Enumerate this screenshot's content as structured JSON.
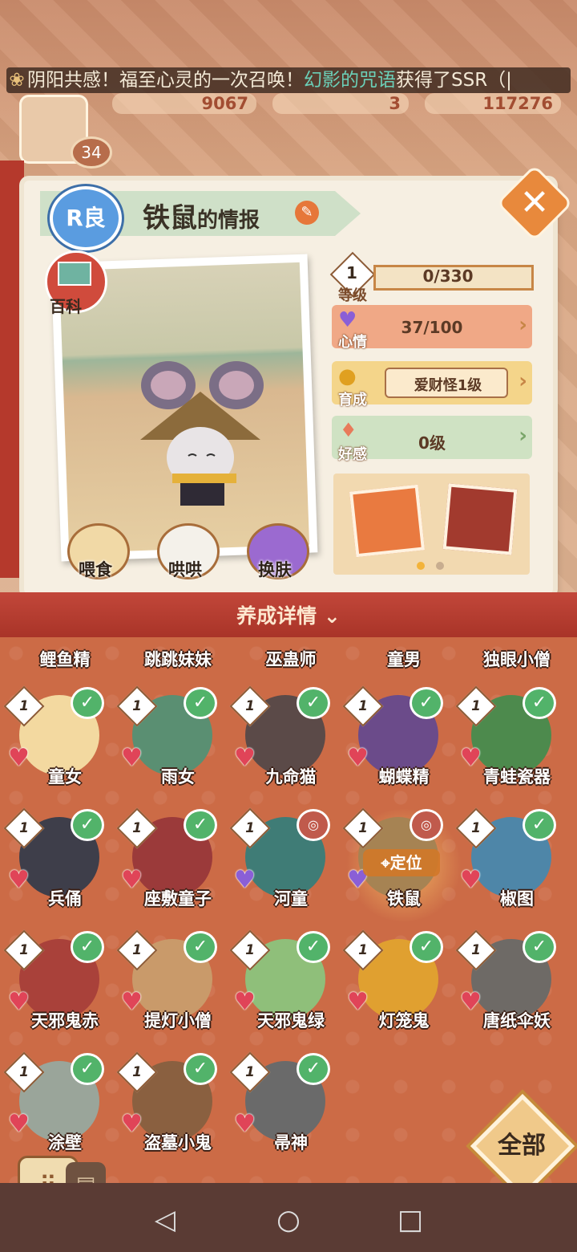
{
  "marquee": {
    "prefix": "阴阳共感！福至心灵的一次召唤！",
    "highlight": "幻影的咒语",
    "suffix": "获得了SSR（|"
  },
  "currency": {
    "jade": "9067",
    "tickets": "3",
    "coins": "117276"
  },
  "player_level": "34",
  "card": {
    "rarity": "R良",
    "name": "铁鼠",
    "title_suffix": "的情报",
    "encyclopedia": "百科"
  },
  "stats": {
    "level": {
      "label": "等级",
      "badge": "1",
      "value": "0/330"
    },
    "mood": {
      "label": "心情",
      "value": "37/100"
    },
    "growth": {
      "label": "育成",
      "value": "爱财怪1级"
    },
    "affection": {
      "label": "好感",
      "value": "0级"
    }
  },
  "actions": [
    {
      "label": "喂食"
    },
    {
      "label": "哄哄"
    },
    {
      "label": "换肤"
    }
  ],
  "training_label": "养成详情",
  "partial_row": [
    "鲤鱼精",
    "跳跳妹妹",
    "巫蛊师",
    "童男",
    "独眼小僧"
  ],
  "shikigami": [
    {
      "name": "童女",
      "level": "1",
      "heart": "red",
      "owned": true,
      "color": "#f3d9a0"
    },
    {
      "name": "雨女",
      "level": "1",
      "heart": "red",
      "owned": true,
      "color": "#5a8f72"
    },
    {
      "name": "九命猫",
      "level": "1",
      "heart": "red",
      "owned": true,
      "color": "#5b4a48"
    },
    {
      "name": "蝴蝶精",
      "level": "1",
      "heart": "red",
      "owned": true,
      "color": "#6b4b8a"
    },
    {
      "name": "青蛙瓷器",
      "level": "1",
      "heart": "red",
      "owned": true,
      "color": "#4d8a4d"
    },
    {
      "name": "兵俑",
      "level": "1",
      "heart": "red",
      "owned": true,
      "color": "#3e3e4a"
    },
    {
      "name": "座敷童子",
      "level": "1",
      "heart": "red",
      "owned": true,
      "color": "#9b3a3a"
    },
    {
      "name": "河童",
      "level": "1",
      "heart": "purple",
      "owned": false,
      "color": "#3f7c76"
    },
    {
      "name": "铁鼠",
      "level": "1",
      "heart": "purple",
      "owned": false,
      "color": "#a68353",
      "locate": "定位"
    },
    {
      "name": "椒图",
      "level": "1",
      "heart": "red",
      "owned": true,
      "color": "#4e86a8"
    },
    {
      "name": "天邪鬼赤",
      "level": "1",
      "heart": "red",
      "owned": true,
      "color": "#a9413a"
    },
    {
      "name": "提灯小僧",
      "level": "1",
      "heart": "red",
      "owned": true,
      "color": "#c99a6a"
    },
    {
      "name": "天邪鬼绿",
      "level": "1",
      "heart": "red",
      "owned": true,
      "color": "#8fbf7a"
    },
    {
      "name": "灯笼鬼",
      "level": "1",
      "heart": "red",
      "owned": true,
      "color": "#e0a030"
    },
    {
      "name": "唐纸伞妖",
      "level": "1",
      "heart": "red",
      "owned": true,
      "color": "#6e6a66"
    },
    {
      "name": "涂壁",
      "level": "1",
      "heart": "red",
      "owned": true,
      "color": "#9aa59a"
    },
    {
      "name": "盗墓小鬼",
      "level": "1",
      "heart": "red",
      "owned": true,
      "color": "#8a6040"
    },
    {
      "name": "帚神",
      "level": "1",
      "heart": "red",
      "owned": true,
      "color": "#6a6a6a"
    }
  ],
  "all_button": "全部",
  "colors": {
    "accent": "#b5392c",
    "grid_bg": "#cc6b46",
    "owned_check": "#52b36a"
  }
}
